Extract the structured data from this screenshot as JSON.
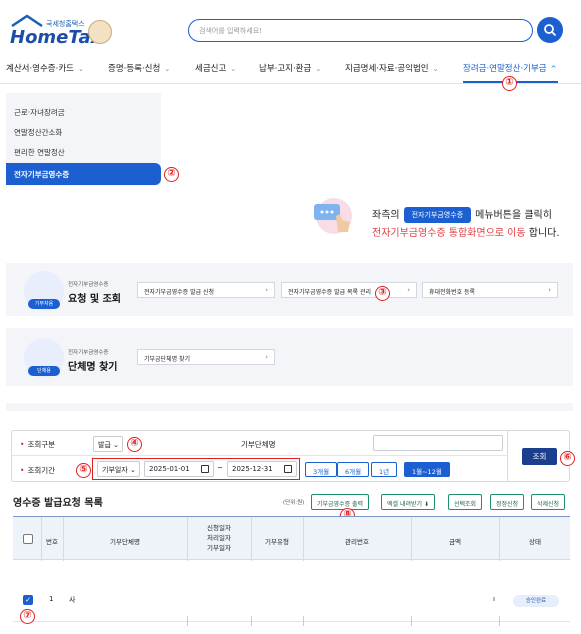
{
  "header": {
    "logo_small": "국세청홈택스",
    "logo": "HomeTax",
    "search_placeholder": "검색어를 입력하세요!"
  },
  "nav": [
    {
      "label": "계산서·영수증·카드"
    },
    {
      "label": "증명·등록·신청"
    },
    {
      "label": "세금신고"
    },
    {
      "label": "납부·고지·환급"
    },
    {
      "label": "지급명세·자료·공익법인"
    },
    {
      "label": "장려금·연말정산·기부금"
    }
  ],
  "submenu": [
    {
      "label": "근로·자녀장려금"
    },
    {
      "label": "연말정산간소화"
    },
    {
      "label": "편리한 연말정산"
    },
    {
      "label": "전자기부금영수증"
    }
  ],
  "guide": {
    "line1_before": "좌측의",
    "chip": "전자기부금영수증",
    "line1_after": "메뉴버튼을 클릭히",
    "line2_red": "전자기부금영수증 통합화면으로 이동",
    "line2_after": "합니다."
  },
  "panel1": {
    "tag": "기부자용",
    "small": "전자기부금영수증",
    "title": "요청 및 조회",
    "buttons": [
      "전자기부금영수증 발급 신청",
      "전자기부금영수증 발급 목록 관리",
      "휴대전화번호 등록"
    ]
  },
  "panel2": {
    "tag": "단체용",
    "small": "전자기부금영수증",
    "title": "단체명 찾기",
    "buttons": [
      "기부금단체명 찾기"
    ]
  },
  "form": {
    "type_label": "조회구분",
    "type_value": "발급",
    "org_label": "기부단체명",
    "period_label": "조회기간",
    "date_type": "기부일자",
    "date_from": "2025-01-01",
    "tilde": "~",
    "date_to": "2025-12-31",
    "periods": [
      "3개월",
      "6개월",
      "1년",
      "1월~12월"
    ],
    "submit": "조회"
  },
  "list": {
    "title": "영수증 발급요청 목록",
    "unit": "(단위:원)",
    "buttons": [
      "기부금영수증 출력",
      "엑셀 내려받기",
      "선택조회",
      "정정신청",
      "삭제신청"
    ],
    "headers": {
      "no": "번호",
      "org": "기부단체명",
      "dates": [
        "신청일자",
        "처리일자",
        "기부일자"
      ],
      "type": "기부유형",
      "mgmt": "관리번호",
      "amount": "금액",
      "status": "상태"
    },
    "rows": [
      {
        "no": "1",
        "org": "사",
        "amount": "ı",
        "status": "승인완료"
      }
    ]
  },
  "markers": [
    "①",
    "②",
    "③",
    "④",
    "⑤",
    "⑥",
    "⑦",
    "⑧"
  ],
  "colors": {
    "primary": "#1b5fd1",
    "marker": "#e02020",
    "navy": "#1b3f8f"
  }
}
